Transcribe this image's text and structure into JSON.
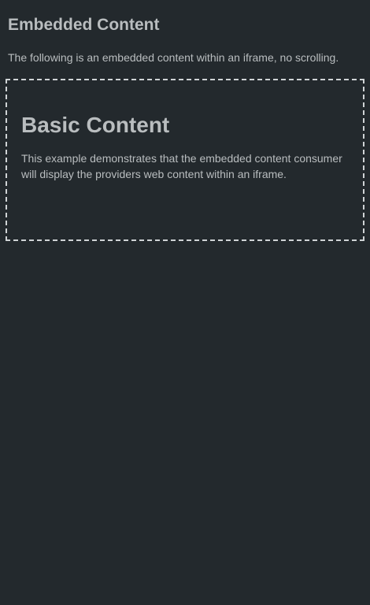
{
  "page": {
    "title": "Embedded Content",
    "description": "The following is an embedded content within an iframe, no scrolling."
  },
  "iframe": {
    "title": "Basic Content",
    "description": "This example demonstrates that the embedded content consumer will display the providers web content within an iframe."
  }
}
